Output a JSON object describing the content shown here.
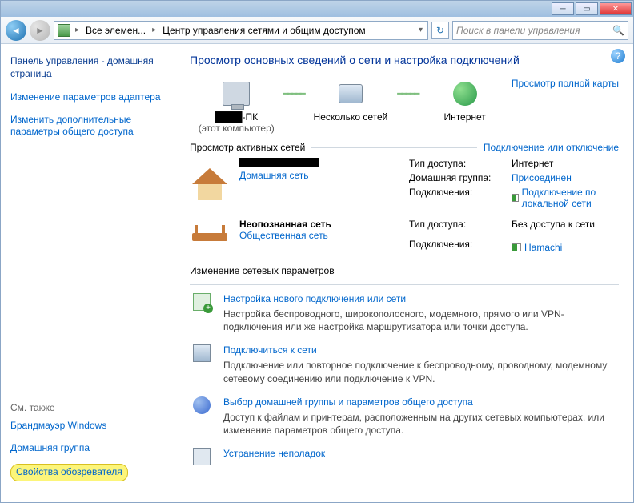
{
  "breadcrumb": {
    "seg1": "Все элемен...",
    "seg2": "Центр управления сетями и общим доступом"
  },
  "search": {
    "placeholder": "Поиск в панели управления"
  },
  "side": {
    "home": "Панель управления - домашняя страница",
    "link1": "Изменение параметров адаптера",
    "link2": "Изменить дополнительные параметры общего доступа",
    "also": "См. также",
    "also1": "Брандмауэр Windows",
    "also2": "Домашняя группа",
    "also3": "Свойства обозревателя"
  },
  "main": {
    "title": "Просмотр основных сведений о сети и настройка подключений",
    "fullmap": "Просмотр полной карты",
    "node1": {
      "name": "████-ПК",
      "sub": "(этот компьютер)"
    },
    "node2": {
      "name": "Несколько сетей"
    },
    "node3": {
      "name": "Интернет"
    },
    "activeHdr": "Просмотр активных сетей",
    "connLink": "Подключение или отключение",
    "net1": {
      "name_black": "████████",
      "type": "Домашняя сеть",
      "k1": "Тип доступа:",
      "v1": "Интернет",
      "k2": "Домашняя группа:",
      "v2": "Присоединен",
      "k3": "Подключения:",
      "v3": "Подключение по локальной сети"
    },
    "net2": {
      "name": "Неопознанная сеть",
      "type": "Общественная сеть",
      "k1": "Тип доступа:",
      "v1": "Без доступа к сети",
      "k2": "Подключения:",
      "v2": "Hamachi"
    },
    "changeHdr": "Изменение сетевых параметров",
    "task1": {
      "link": "Настройка нового подключения или сети",
      "desc": "Настройка беспроводного, широкополосного, модемного, прямого или VPN-подключения или же настройка маршрутизатора или точки доступа."
    },
    "task2": {
      "link": "Подключиться к сети",
      "desc": "Подключение или повторное подключение к беспроводному, проводному, модемному сетевому соединению или подключение к VPN."
    },
    "task3": {
      "link": "Выбор домашней группы и параметров общего доступа",
      "desc": "Доступ к файлам и принтерам, расположенным на других сетевых компьютерах, или изменение параметров общего доступа."
    },
    "task4": {
      "link": "Устранение неполадок"
    }
  }
}
